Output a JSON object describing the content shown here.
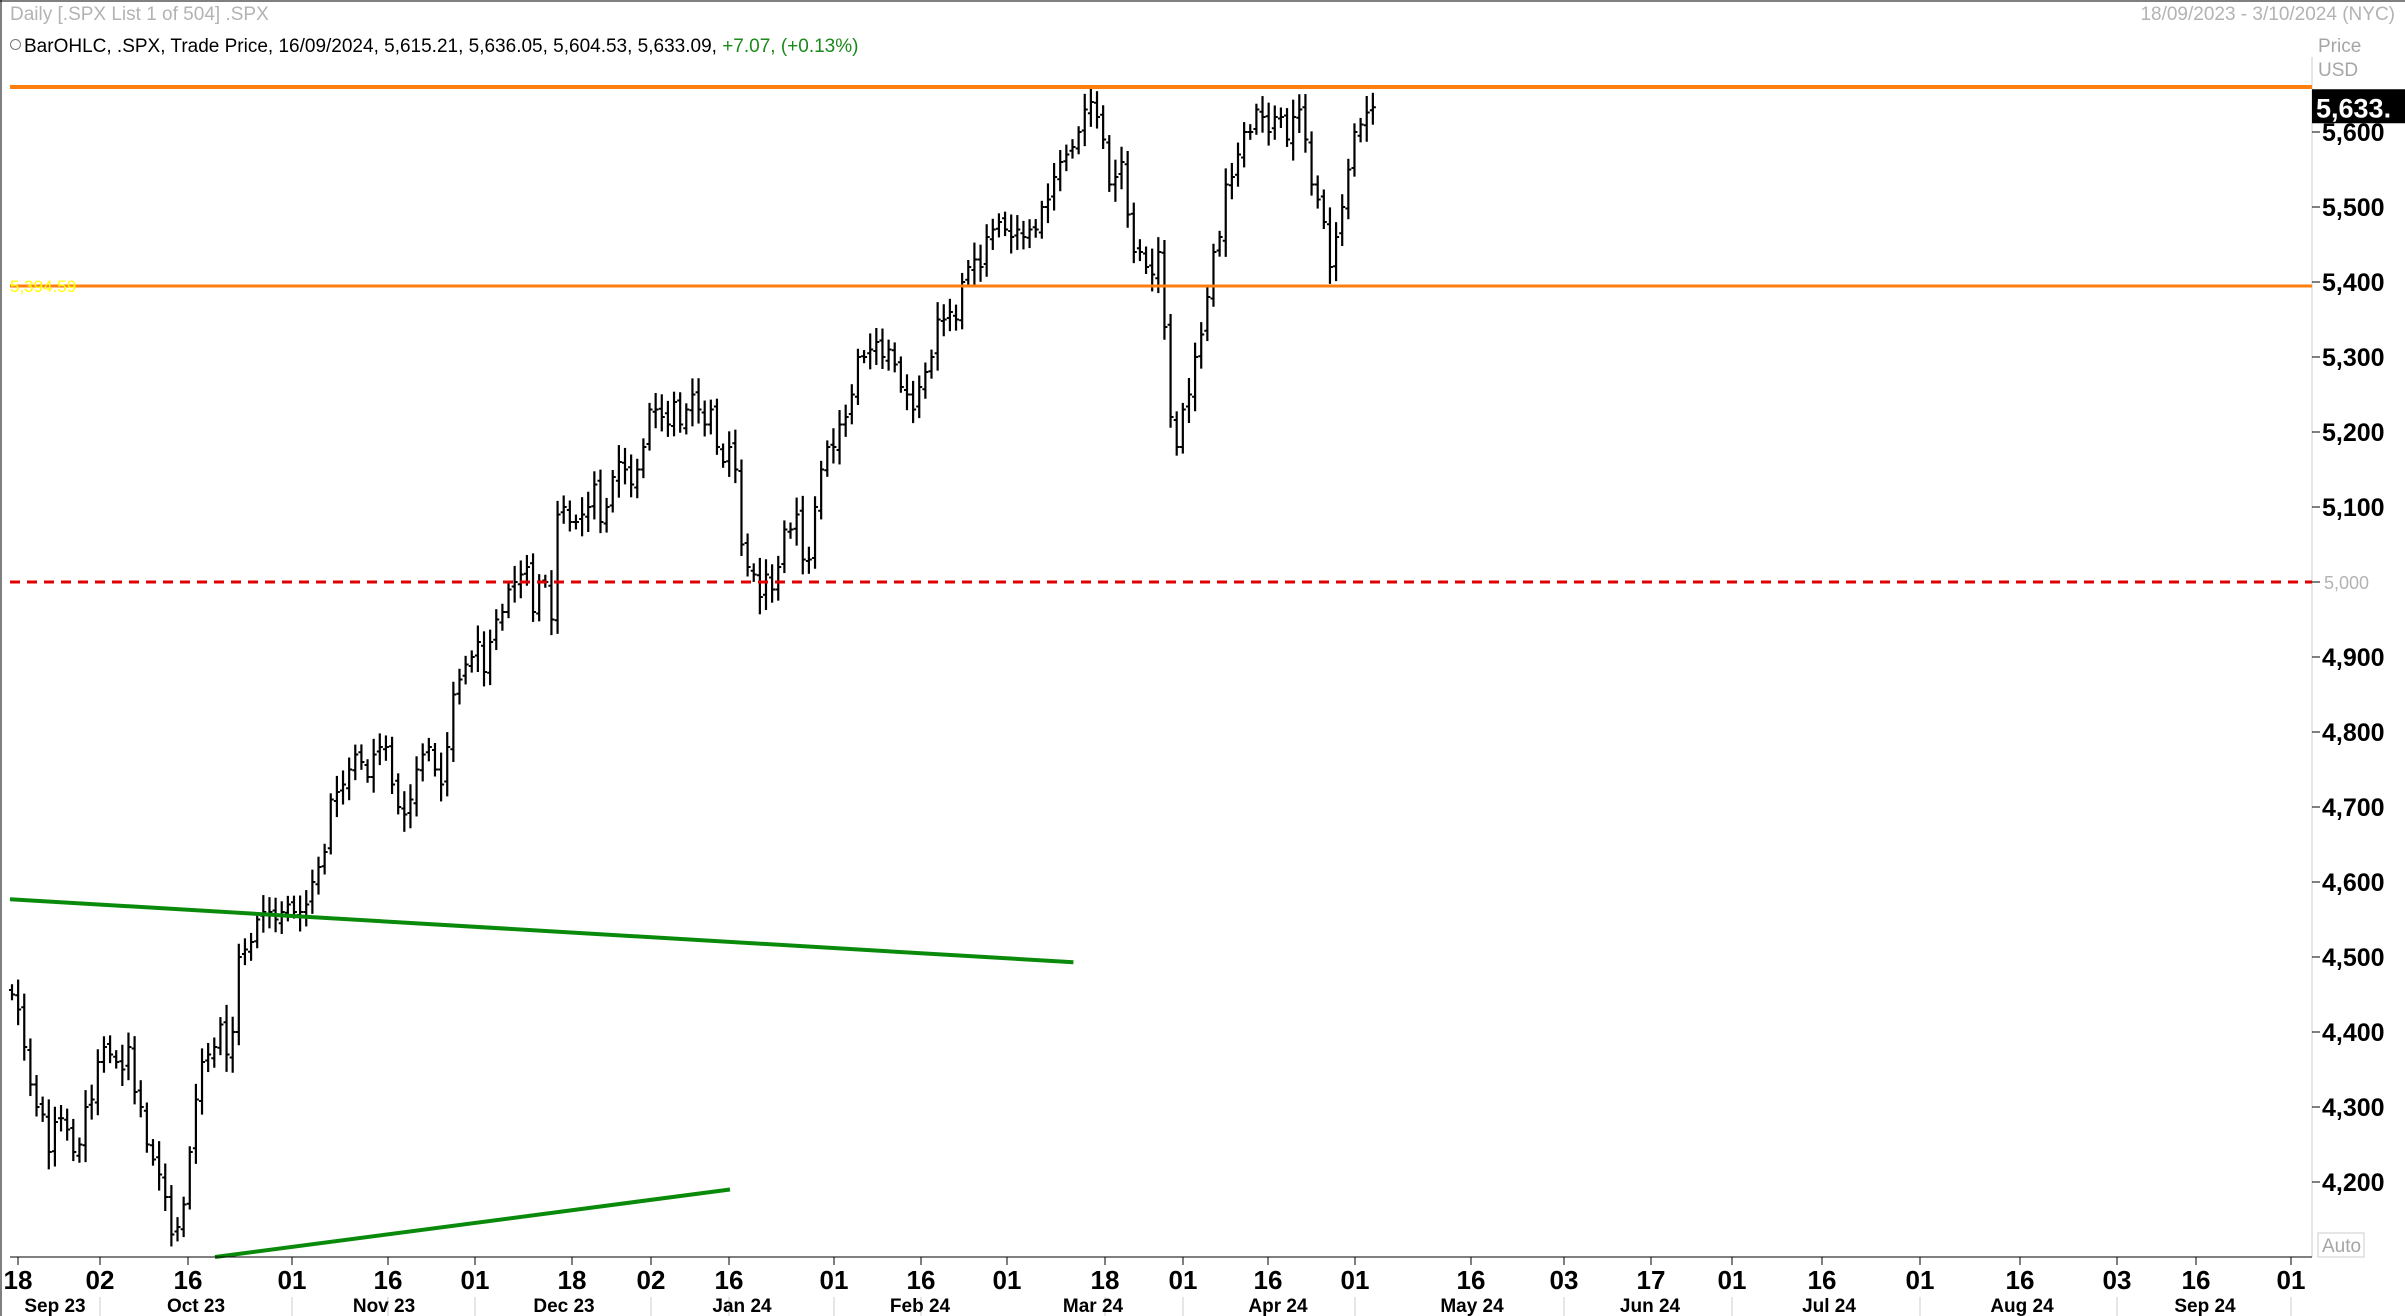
{
  "header": {
    "left": "Daily [.SPX List 1 of 504] .SPX",
    "right": "18/09/2023 - 3/10/2024 (NYC)"
  },
  "legend": {
    "prefix": "BarOHLC, .SPX, Trade Price, 16/09/2024, 5,615.21, 5,636.05, 5,604.53, 5,633.09,",
    "change": "+7.07, (+0.13%)"
  },
  "axis_title": {
    "line1": "Price",
    "line2": "USD"
  },
  "auto_label": "Auto",
  "last_price_label": "5,633.",
  "colors": {
    "bars": "#000000",
    "resistance_line": "#ff7f0e",
    "support_line": "#ff7f0e",
    "dashed_line": "#e00000",
    "trend_lines": "#0a8a0a",
    "level_label": "#ffff00"
  },
  "chart_data": {
    "type": "ohlc_bar",
    "title": "",
    "ylabel": "Price USD",
    "ylim": [
      4105,
      5720
    ],
    "yticks": [
      4200,
      4300,
      4400,
      4500,
      4600,
      4700,
      4800,
      4900,
      5000,
      5100,
      5200,
      5300,
      5400,
      5500,
      5600
    ],
    "ytick_labels": [
      "4,200",
      "4,300",
      "4,400",
      "4,500",
      "4,600",
      "4,700",
      "4,800",
      "4,900",
      "5,000",
      "5,100",
      "5,200",
      "5,300",
      "5,400",
      "5,500",
      "5,600"
    ],
    "xtick_labels": [
      "18",
      "02",
      "16",
      "01",
      "16",
      "01",
      "18",
      "02",
      "16",
      "01",
      "16",
      "01",
      "18",
      "01",
      "16",
      "01",
      "16",
      "03",
      "17",
      "01",
      "16",
      "01",
      "16",
      "03",
      "16",
      "01"
    ],
    "month_labels": [
      "Sep 23",
      "Oct 23",
      "Nov 23",
      "Dec 23",
      "Jan 24",
      "Feb 24",
      "Mar 24",
      "Apr 24",
      "May 24",
      "Jun 24",
      "Jul 24",
      "Aug 24",
      "Sep 24"
    ],
    "grid": false,
    "closes": [
      4450,
      4430,
      4380,
      4330,
      4300,
      4290,
      4240,
      4280,
      4285,
      4270,
      4240,
      4250,
      4300,
      4310,
      4360,
      4380,
      4370,
      4360,
      4350,
      4380,
      4320,
      4300,
      4250,
      4230,
      4210,
      4180,
      4130,
      4140,
      4170,
      4240,
      4310,
      4360,
      4370,
      4380,
      4410,
      4370,
      4400,
      4500,
      4510,
      4520,
      4550,
      4560,
      4560,
      4550,
      4560,
      4570,
      4560,
      4560,
      4570,
      4600,
      4620,
      4640,
      4710,
      4720,
      4730,
      4750,
      4770,
      4760,
      4740,
      4770,
      4780,
      4780,
      4730,
      4700,
      4690,
      4710,
      4750,
      4770,
      4780,
      4750,
      4730,
      4780,
      4850,
      4870,
      4890,
      4900,
      4920,
      4880,
      4920,
      4950,
      4960,
      4990,
      5000,
      5010,
      5020,
      4960,
      5000,
      5000,
      4950,
      5090,
      5100,
      5080,
      5080,
      5090,
      5100,
      5130,
      5080,
      5100,
      5140,
      5160,
      5150,
      5130,
      5150,
      5180,
      5230,
      5230,
      5220,
      5210,
      5240,
      5210,
      5230,
      5250,
      5230,
      5210,
      5230,
      5180,
      5160,
      5180,
      5150,
      5050,
      5020,
      5010,
      4980,
      5010,
      4990,
      5020,
      5070,
      5070,
      5090,
      5030,
      5030,
      5100,
      5150,
      5180,
      5180,
      5210,
      5220,
      5250,
      5300,
      5300,
      5310,
      5320,
      5300,
      5310,
      5290,
      5260,
      5250,
      5230,
      5260,
      5280,
      5300,
      5350,
      5350,
      5360,
      5350,
      5400,
      5420,
      5430,
      5420,
      5460,
      5470,
      5480,
      5470,
      5460,
      5470,
      5460,
      5470,
      5470,
      5500,
      5510,
      5540,
      5560,
      5570,
      5580,
      5600,
      5630,
      5640,
      5620,
      5590,
      5530,
      5540,
      5560,
      5490,
      5440,
      5440,
      5420,
      5410,
      5440,
      5340,
      5220,
      5180,
      5230,
      5250,
      5300,
      5330,
      5380,
      5440,
      5460,
      5530,
      5540,
      5570,
      5600,
      5600,
      5630,
      5620,
      5600,
      5620,
      5620,
      5590,
      5620,
      5630,
      5590,
      5530,
      5510,
      5480,
      5420,
      5460,
      5500,
      5550,
      5600,
      5610,
      5626,
      5633
    ]
  },
  "levels": {
    "resistance": 5660,
    "support": 5394.59,
    "support_label": "5,394.59",
    "psych": 5000,
    "psych_label": "5,000"
  },
  "trend_lines": {
    "upper": [
      [
        4577,
        0
      ],
      [
        4493,
        134
      ]
    ],
    "lower": [
      [
        4100,
        26
      ],
      [
        4190,
        94
      ]
    ]
  }
}
